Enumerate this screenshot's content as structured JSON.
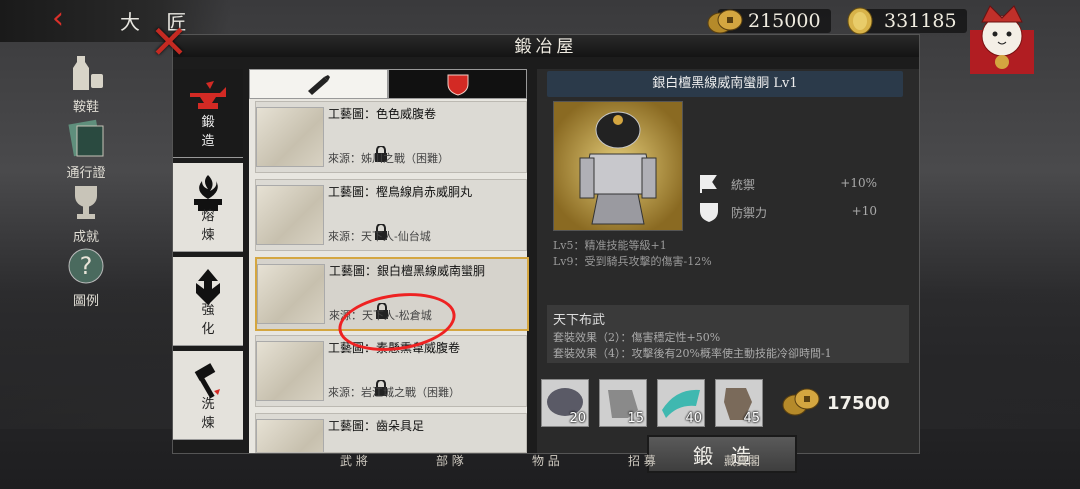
{
  "top": {
    "title": "大 匠",
    "currency": [
      {
        "icon": "coins-icon",
        "value": "215000"
      },
      {
        "icon": "gold-bar-icon",
        "value": "331185"
      }
    ]
  },
  "side_menu": [
    {
      "label": "鞍鞋",
      "icon": "sake-icon"
    },
    {
      "label": "通行證",
      "icon": "pass-icon"
    },
    {
      "label": "成就",
      "icon": "trophy-icon"
    },
    {
      "label": "圖例",
      "icon": "question-icon"
    }
  ],
  "panel": {
    "title": "鍛冶屋",
    "tabs": [
      {
        "label": "鍛 造",
        "icon": "anvil-icon"
      },
      {
        "label": "熔 煉",
        "icon": "furnace-icon"
      },
      {
        "label": "強 化",
        "icon": "upgrade-icon"
      },
      {
        "label": "洗 煉",
        "icon": "hammer-icon"
      }
    ],
    "type_tabs": [
      {
        "icon": "sword-icon"
      },
      {
        "icon": "shield-icon"
      }
    ],
    "recipes": [
      {
        "name": "工藝圖：色色威腹卷",
        "source": "來源：姊川之戰（困難）"
      },
      {
        "name": "工藝圖：樫鳥線肩赤威胴丸",
        "source": "來源：天下人-仙台城"
      },
      {
        "name": "工藝圖：銀白檀黑線威南蠻胴",
        "source": "來源：天下人-松倉城"
      },
      {
        "name": "工藝圖：素懸熏韋威腹卷",
        "source": "來源：岩江城之戰（困難）"
      },
      {
        "name": "工藝圖：齒朵具足",
        "source": ""
      }
    ]
  },
  "detail": {
    "header": "銀白檀黑線威南蠻胴 Lv1",
    "stats": [
      {
        "label": "統禦",
        "value": "+10%",
        "icon": "flag-icon"
      },
      {
        "label": "防禦力",
        "value": "+10",
        "icon": "shield-icon"
      }
    ],
    "effects": [
      "Lv5：精准技能等級+1",
      "Lv9：受到騎兵攻擊的傷害-12%"
    ],
    "set": {
      "title": "天下布武",
      "lines": [
        "套裝效果（2）：傷害穩定性+50%",
        "套裝效果（4）：攻擊後有20%概率使主動技能冷卻時間-1"
      ]
    },
    "materials": [
      {
        "count": "20",
        "icon": "ore-icon",
        "color": "#6a6a72"
      },
      {
        "count": "15",
        "icon": "cloth-icon",
        "color": "#8a8a8a"
      },
      {
        "count": "40",
        "icon": "silk-icon",
        "color": "#3fb8b0"
      },
      {
        "count": "45",
        "icon": "leather-icon",
        "color": "#7a6a5a"
      }
    ],
    "cost": "17500",
    "forge_label": "鍛造"
  },
  "bottom_nav": [
    "武 將",
    "部 隊",
    "物 品",
    "招 募",
    "藏寶閣"
  ]
}
